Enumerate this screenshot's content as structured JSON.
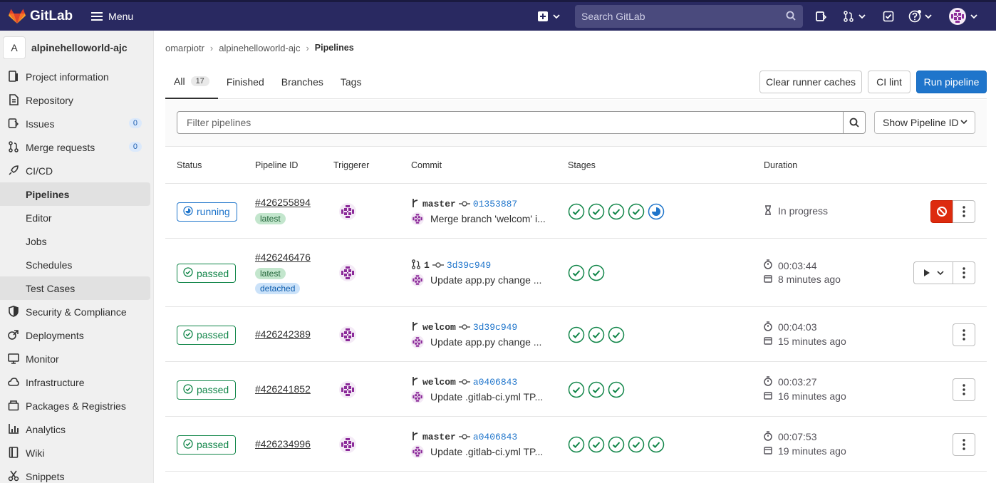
{
  "topbar": {
    "brand": "GitLab",
    "menu_label": "Menu",
    "search_placeholder": "Search GitLab",
    "icons": [
      "plus-icon",
      "search-icon",
      "issues-icon",
      "merge-request-icon",
      "todo-icon",
      "help-icon",
      "avatar"
    ]
  },
  "sidebar": {
    "project_initial": "A",
    "project_name": "alpinehelloworld-ajc",
    "items": [
      {
        "label": "Project information",
        "icon": "info-icon"
      },
      {
        "label": "Repository",
        "icon": "doc-icon"
      },
      {
        "label": "Issues",
        "icon": "issues-icon",
        "badge": "0"
      },
      {
        "label": "Merge requests",
        "icon": "merge-request-icon",
        "badge": "0"
      },
      {
        "label": "CI/CD",
        "icon": "rocket-icon"
      },
      {
        "label": "Pipelines"
      },
      {
        "label": "Editor"
      },
      {
        "label": "Jobs"
      },
      {
        "label": "Schedules"
      },
      {
        "label": "Test Cases"
      },
      {
        "label": "Security & Compliance",
        "icon": "shield-icon"
      },
      {
        "label": "Deployments",
        "icon": "deployments-icon"
      },
      {
        "label": "Monitor",
        "icon": "monitor-icon"
      },
      {
        "label": "Infrastructure",
        "icon": "cloud-icon"
      },
      {
        "label": "Packages & Registries",
        "icon": "package-icon"
      },
      {
        "label": "Analytics",
        "icon": "chart-icon"
      },
      {
        "label": "Wiki",
        "icon": "book-icon"
      },
      {
        "label": "Snippets",
        "icon": "scissors-icon"
      }
    ]
  },
  "breadcrumb": [
    "omarpiotr",
    "alpinehelloworld-ajc",
    "Pipelines"
  ],
  "tabs": [
    {
      "label": "All",
      "count": "17"
    },
    {
      "label": "Finished"
    },
    {
      "label": "Branches"
    },
    {
      "label": "Tags"
    }
  ],
  "actions": {
    "clear_cache": "Clear runner caches",
    "ci_lint": "CI lint",
    "run_pipeline": "Run pipeline"
  },
  "filter": {
    "placeholder": "Filter pipelines",
    "id_select": "Show Pipeline ID"
  },
  "columns": [
    "Status",
    "Pipeline ID",
    "Triggerer",
    "Commit",
    "Stages",
    "Duration"
  ],
  "pipelines": [
    {
      "status": "running",
      "id": "#426255894",
      "labels": [
        "latest"
      ],
      "ref_type": "branch",
      "ref": "master",
      "sha": "01353887",
      "message": "Merge branch 'welcom' i...",
      "stages": [
        "passed",
        "passed",
        "passed",
        "passed",
        "running"
      ],
      "duration": "In progress",
      "finished": ""
    },
    {
      "status": "passed",
      "id": "#426246476",
      "labels": [
        "latest",
        "detached"
      ],
      "ref_type": "merge-request",
      "ref": "1",
      "sha": "3d39c949",
      "message": "Update app.py change ...",
      "stages": [
        "passed",
        "passed"
      ],
      "duration": "00:03:44",
      "finished": "8 minutes ago"
    },
    {
      "status": "passed",
      "id": "#426242389",
      "labels": [],
      "ref_type": "branch",
      "ref": "welcom",
      "sha": "3d39c949",
      "message": "Update app.py change ...",
      "stages": [
        "passed",
        "passed",
        "passed"
      ],
      "duration": "00:04:03",
      "finished": "15 minutes ago"
    },
    {
      "status": "passed",
      "id": "#426241852",
      "labels": [],
      "ref_type": "branch",
      "ref": "welcom",
      "sha": "a0406843",
      "message": "Update .gitlab-ci.yml TP...",
      "stages": [
        "passed",
        "passed",
        "passed"
      ],
      "duration": "00:03:27",
      "finished": "16 minutes ago"
    },
    {
      "status": "passed",
      "id": "#426234996",
      "labels": [],
      "ref_type": "branch",
      "ref": "master",
      "sha": "a0406843",
      "message": "Update .gitlab-ci.yml TP...",
      "stages": [
        "passed",
        "passed",
        "passed",
        "passed",
        "passed"
      ],
      "duration": "00:07:53",
      "finished": "19 minutes ago"
    }
  ],
  "colors": {
    "topbar": "#292961",
    "passed": "#108548",
    "running": "#1f75cb",
    "primary": "#1f75cb",
    "cancel": "#dd2b0e"
  }
}
